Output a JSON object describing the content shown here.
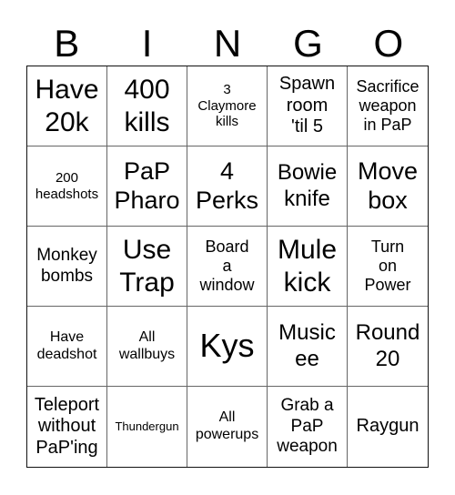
{
  "header": {
    "letters": [
      "B",
      "I",
      "N",
      "G",
      "O"
    ]
  },
  "card": {
    "rows": [
      [
        "Have\n20k",
        "400\nkills",
        "3\nClaymore\nkills",
        "Spawn\nroom\n'til 5",
        "Sacrifice\nweapon\nin PaP"
      ],
      [
        "200\nheadshots",
        "PaP\nPharo",
        "4\nPerks",
        "Bowie\nknife",
        "Move\nbox"
      ],
      [
        "Monkey\nbombs",
        "Use\nTrap",
        "Board\na\nwindow",
        "Mule\nkick",
        "Turn\non\nPower"
      ],
      [
        "Have\ndeadshot",
        "All\nwallbuys",
        "Kys",
        "Music\nee",
        "Round\n20"
      ],
      [
        "Teleport\nwithout\nPaP'ing",
        "Thundergun",
        "All\npowerups",
        "Grab a\nPaP\nweapon",
        "Raygun"
      ]
    ]
  },
  "colors": {
    "outer_border": "#111111",
    "inner_lines": "#666666",
    "text": "#000000",
    "background": "#ffffff"
  }
}
